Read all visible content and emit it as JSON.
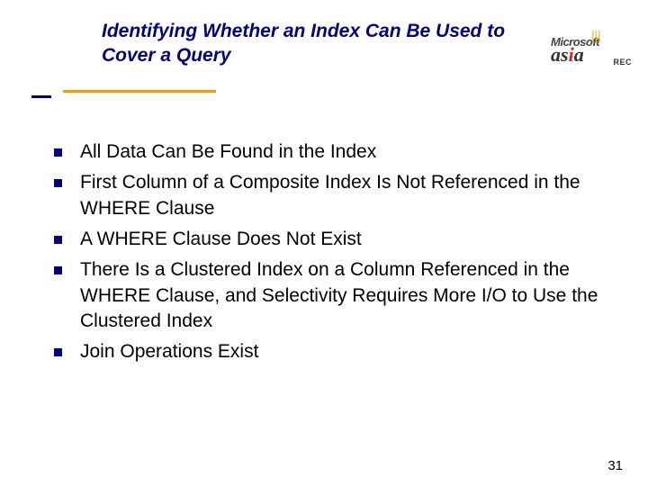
{
  "title": "Identifying Whether an Index Can Be Used to Cover a Query",
  "logo": {
    "microsoft": "Microsoft",
    "asia": "asia",
    "rec": "REC"
  },
  "bullets": [
    "All Data Can Be Found in the Index",
    "First Column of a Composite Index Is Not Referenced in the WHERE Clause",
    "A WHERE Clause Does Not Exist",
    "There Is a Clustered Index on a Column Referenced in the WHERE Clause, and Selectivity Requires More I/O to Use the Clustered Index",
    "Join Operations Exist"
  ],
  "page_number": "31"
}
